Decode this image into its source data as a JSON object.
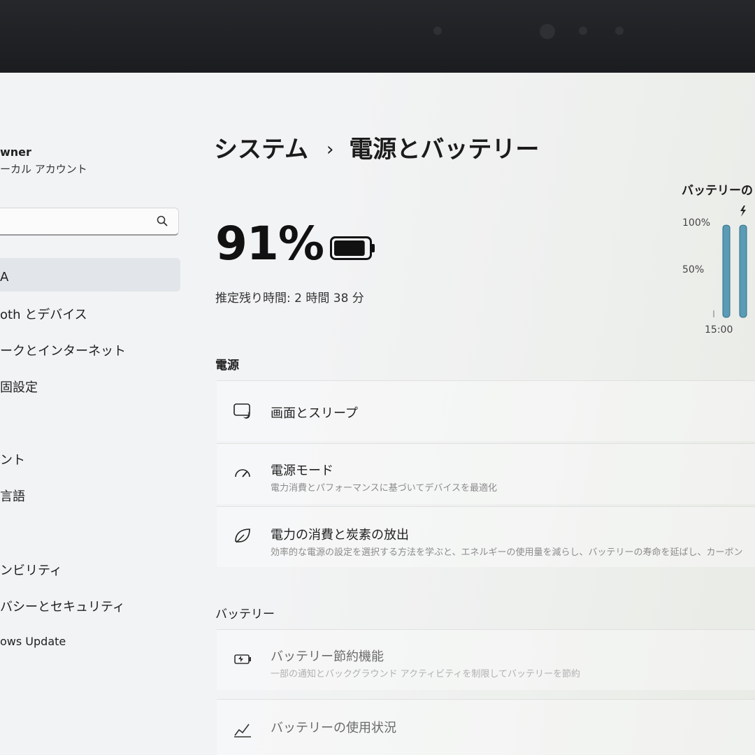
{
  "account": {
    "name": "wner",
    "type": "ーカル アカウント"
  },
  "search": {
    "placeholder": ""
  },
  "nav": {
    "items": [
      {
        "label": "A"
      },
      {
        "label": "oth とデバイス"
      },
      {
        "label": "ークとインターネット"
      },
      {
        "label": "固設定"
      },
      {
        "label": "ント"
      },
      {
        "label": "言語"
      },
      {
        "label": "ンビリティ"
      },
      {
        "label": "バシーとセキュリティ"
      },
      {
        "label": "ows Update"
      }
    ]
  },
  "breadcrumb": {
    "parent": "システム",
    "separator": "›",
    "current": "電源とバッテリー"
  },
  "battery": {
    "percent_label": "91%",
    "level": 0.91,
    "remaining": "推定残り時間: 2 時間 38 分"
  },
  "sections": {
    "power": {
      "heading": "電源",
      "items": [
        {
          "title": "画面とスリープ",
          "subtitle": "",
          "icon": "screen-sleep-icon"
        },
        {
          "title": "電源モード",
          "subtitle": "電力消費とパフォーマンスに基づいてデバイスを最適化",
          "icon": "power-mode-gauge-icon"
        },
        {
          "title": "電力の消費と炭素の放出",
          "subtitle": "効率的な電源の設定を選択する方法を学ぶと、エネルギーの使用量を減らし、バッテリーの寿命を延ばし、カーボン",
          "icon": "leaf-icon"
        }
      ]
    },
    "battery": {
      "heading": "バッテリー",
      "items": [
        {
          "title": "バッテリー節約機能",
          "subtitle": "一部の通知とバックグラウンド アクティビティを制限してバッテリーを節約",
          "icon": "battery-saver-icon"
        },
        {
          "title": "バッテリーの使用状況",
          "subtitle": "",
          "icon": "usage-chart-icon"
        }
      ]
    }
  },
  "chart_data": {
    "type": "bar",
    "title": "バッテリーのレ",
    "y_ticks": [
      "100%",
      "50%"
    ],
    "x_ticks": [
      "15:00"
    ],
    "ylim": [
      0,
      100
    ],
    "values": [
      97,
      97
    ],
    "charging_indicator": "lightning-icon",
    "color": "#5b9bb6"
  },
  "colors": {
    "accent": "#5b9bb6",
    "selected_nav": "#e2e5e9"
  }
}
